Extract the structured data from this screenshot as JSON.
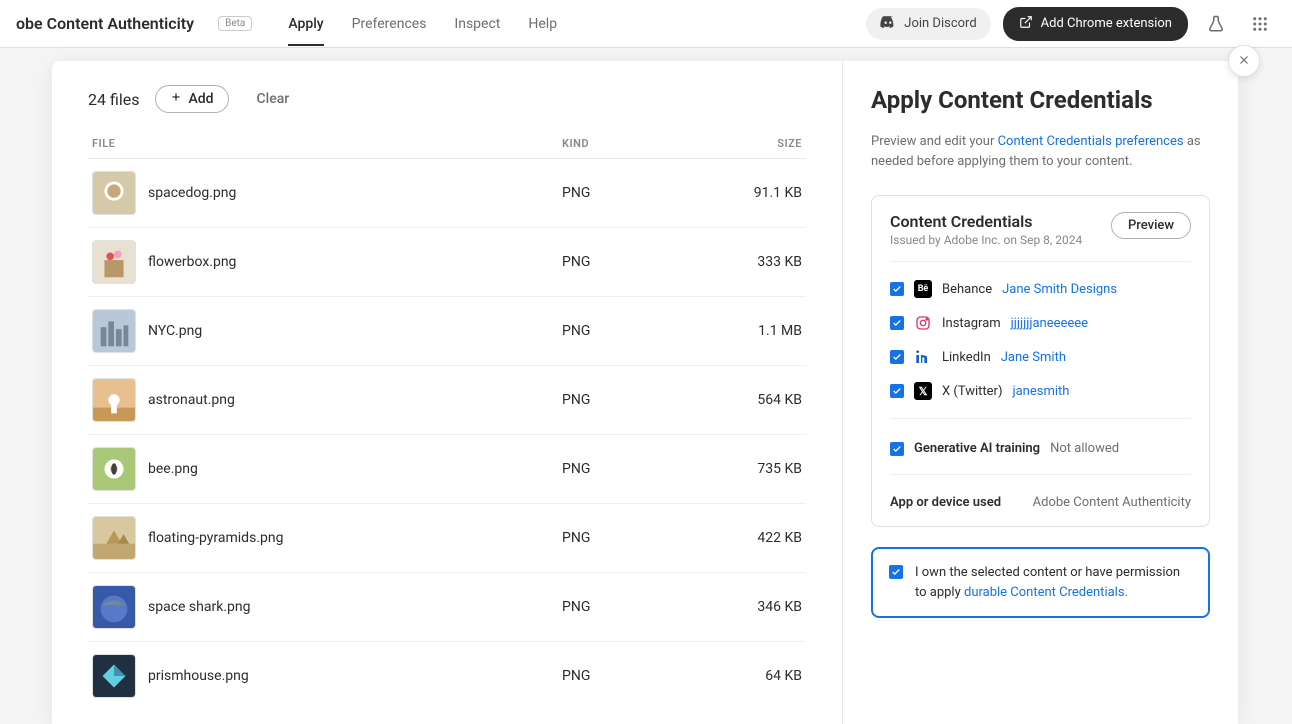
{
  "topbar": {
    "brand": "obe Content Authenticity",
    "beta": "Beta",
    "tabs": [
      "Apply",
      "Preferences",
      "Inspect",
      "Help"
    ],
    "active_tab": 0,
    "discord": "Join Discord",
    "chrome": "Add Chrome extension"
  },
  "files": {
    "count": "24 files",
    "add": "Add",
    "clear": "Clear",
    "headers": {
      "file": "File",
      "kind": "Kind",
      "size": "Size"
    },
    "rows": [
      {
        "name": "spacedog.png",
        "kind": "PNG",
        "size": "91.1 KB"
      },
      {
        "name": "flowerbox.png",
        "kind": "PNG",
        "size": "333 KB"
      },
      {
        "name": "NYC.png",
        "kind": "PNG",
        "size": "1.1 MB"
      },
      {
        "name": "astronaut.png",
        "kind": "PNG",
        "size": "564 KB"
      },
      {
        "name": "bee.png",
        "kind": "PNG",
        "size": "735 KB"
      },
      {
        "name": "floating-pyramids.png",
        "kind": "PNG",
        "size": "422 KB"
      },
      {
        "name": "space shark.png",
        "kind": "PNG",
        "size": "346 KB"
      },
      {
        "name": "prismhouse.png",
        "kind": "PNG",
        "size": "64 KB"
      }
    ]
  },
  "panel": {
    "title": "Apply Content Credentials",
    "desc_pre": "Preview and edit your ",
    "desc_link": "Content Credentials preferences",
    "desc_post": " as needed before applying them to your content.",
    "cred_title": "Content Credentials",
    "cred_sub": "Issued by Adobe Inc. on Sep 8, 2024",
    "preview": "Preview",
    "socials": [
      {
        "platform": "Behance",
        "handle": "Jane Smith Designs",
        "icon": "behance"
      },
      {
        "platform": "Instagram",
        "handle": "jjjjjjjaneeeeee",
        "icon": "instagram"
      },
      {
        "platform": "LinkedIn",
        "handle": "Jane Smith",
        "icon": "linkedin"
      },
      {
        "platform": "X (Twitter)",
        "handle": "janesmith",
        "icon": "twitter"
      }
    ],
    "gen_label": "Generative AI training",
    "gen_val": "Not allowed",
    "app_label": "App or device used",
    "app_val": "Adobe Content Authenticity",
    "own_pre": "I own the selected content or have permission to apply ",
    "own_link": "durable Content Credentials."
  }
}
